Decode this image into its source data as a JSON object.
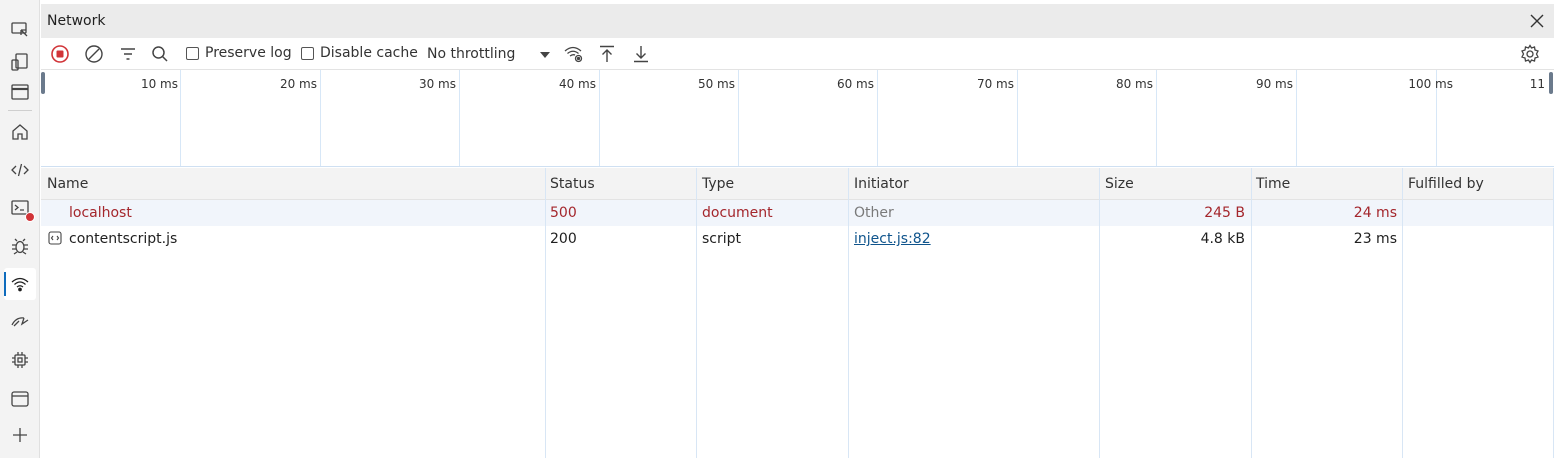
{
  "activity_bar": {
    "items": [
      {
        "name": "inspect-element-icon"
      },
      {
        "name": "device-emulation-icon"
      },
      {
        "name": "toggle-drawer-icon"
      },
      {
        "name": "welcome-home-icon"
      },
      {
        "name": "elements-icon"
      },
      {
        "name": "console-icon",
        "badge": true
      },
      {
        "name": "sources-debugger-icon"
      },
      {
        "name": "network-wifi-icon",
        "active": true
      },
      {
        "name": "performance-icon"
      },
      {
        "name": "memory-chip-icon"
      },
      {
        "name": "application-icon"
      },
      {
        "name": "more-tools-plus-icon"
      }
    ]
  },
  "panel": {
    "title": "Network",
    "toolbar": {
      "preserve_log": "Preserve log",
      "disable_cache": "Disable cache",
      "throttling": "No throttling"
    }
  },
  "overview": {
    "ticks": [
      "10 ms",
      "20 ms",
      "30 ms",
      "40 ms",
      "50 ms",
      "60 ms",
      "70 ms",
      "80 ms",
      "90 ms",
      "100 ms",
      "11"
    ]
  },
  "table": {
    "columns": [
      "Name",
      "Status",
      "Type",
      "Initiator",
      "Size",
      "Time",
      "Fulfilled by"
    ],
    "rows": [
      {
        "name": "localhost",
        "status": "500",
        "type": "document",
        "initiator": "Other",
        "size": "245 B",
        "time": "24 ms",
        "fulfilled_by": "",
        "error": true
      },
      {
        "name": "contentscript.js",
        "status": "200",
        "type": "script",
        "initiator": "inject.js:82",
        "size": "4.8 kB",
        "time": "23 ms",
        "fulfilled_by": "",
        "error": false
      }
    ]
  },
  "colors": {
    "accent": "#0f6cbd",
    "error": "#a4262c",
    "record": "#d13438",
    "link": "#0f548c"
  }
}
